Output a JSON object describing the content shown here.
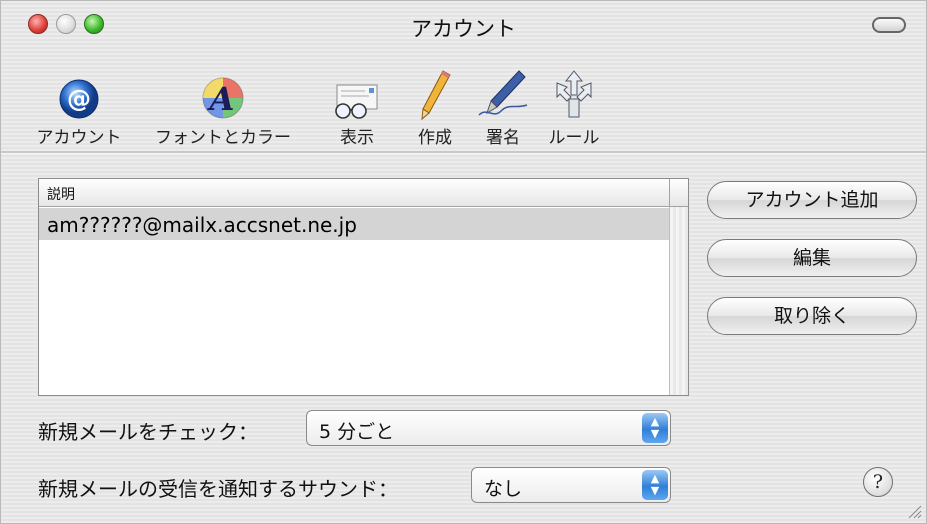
{
  "window": {
    "title": "アカウント"
  },
  "toolbar": {
    "items": [
      {
        "label": "アカウント",
        "icon": "at-sign-icon"
      },
      {
        "label": "フォントとカラー",
        "icon": "font-color-icon"
      },
      {
        "label": "表示",
        "icon": "glasses-icon"
      },
      {
        "label": "作成",
        "icon": "pencil-icon"
      },
      {
        "label": "署名",
        "icon": "fountain-pen-icon"
      },
      {
        "label": "ルール",
        "icon": "rules-arrows-icon"
      }
    ]
  },
  "accounts": {
    "column_header": "説明",
    "rows": [
      "am??????@mailx.accsnet.ne.jp"
    ]
  },
  "buttons": {
    "add": "アカウント追加",
    "edit": "編集",
    "remove": "取り除く"
  },
  "check_mail": {
    "label": "新規メールをチェック：",
    "value": "5 分ごと"
  },
  "notify_sound": {
    "label": "新規メールの受信を通知するサウンド：",
    "value": "なし"
  },
  "help": {
    "glyph": "?"
  },
  "colors": {
    "accent": "#2f7fd6",
    "selection": "#d4d4d4"
  }
}
